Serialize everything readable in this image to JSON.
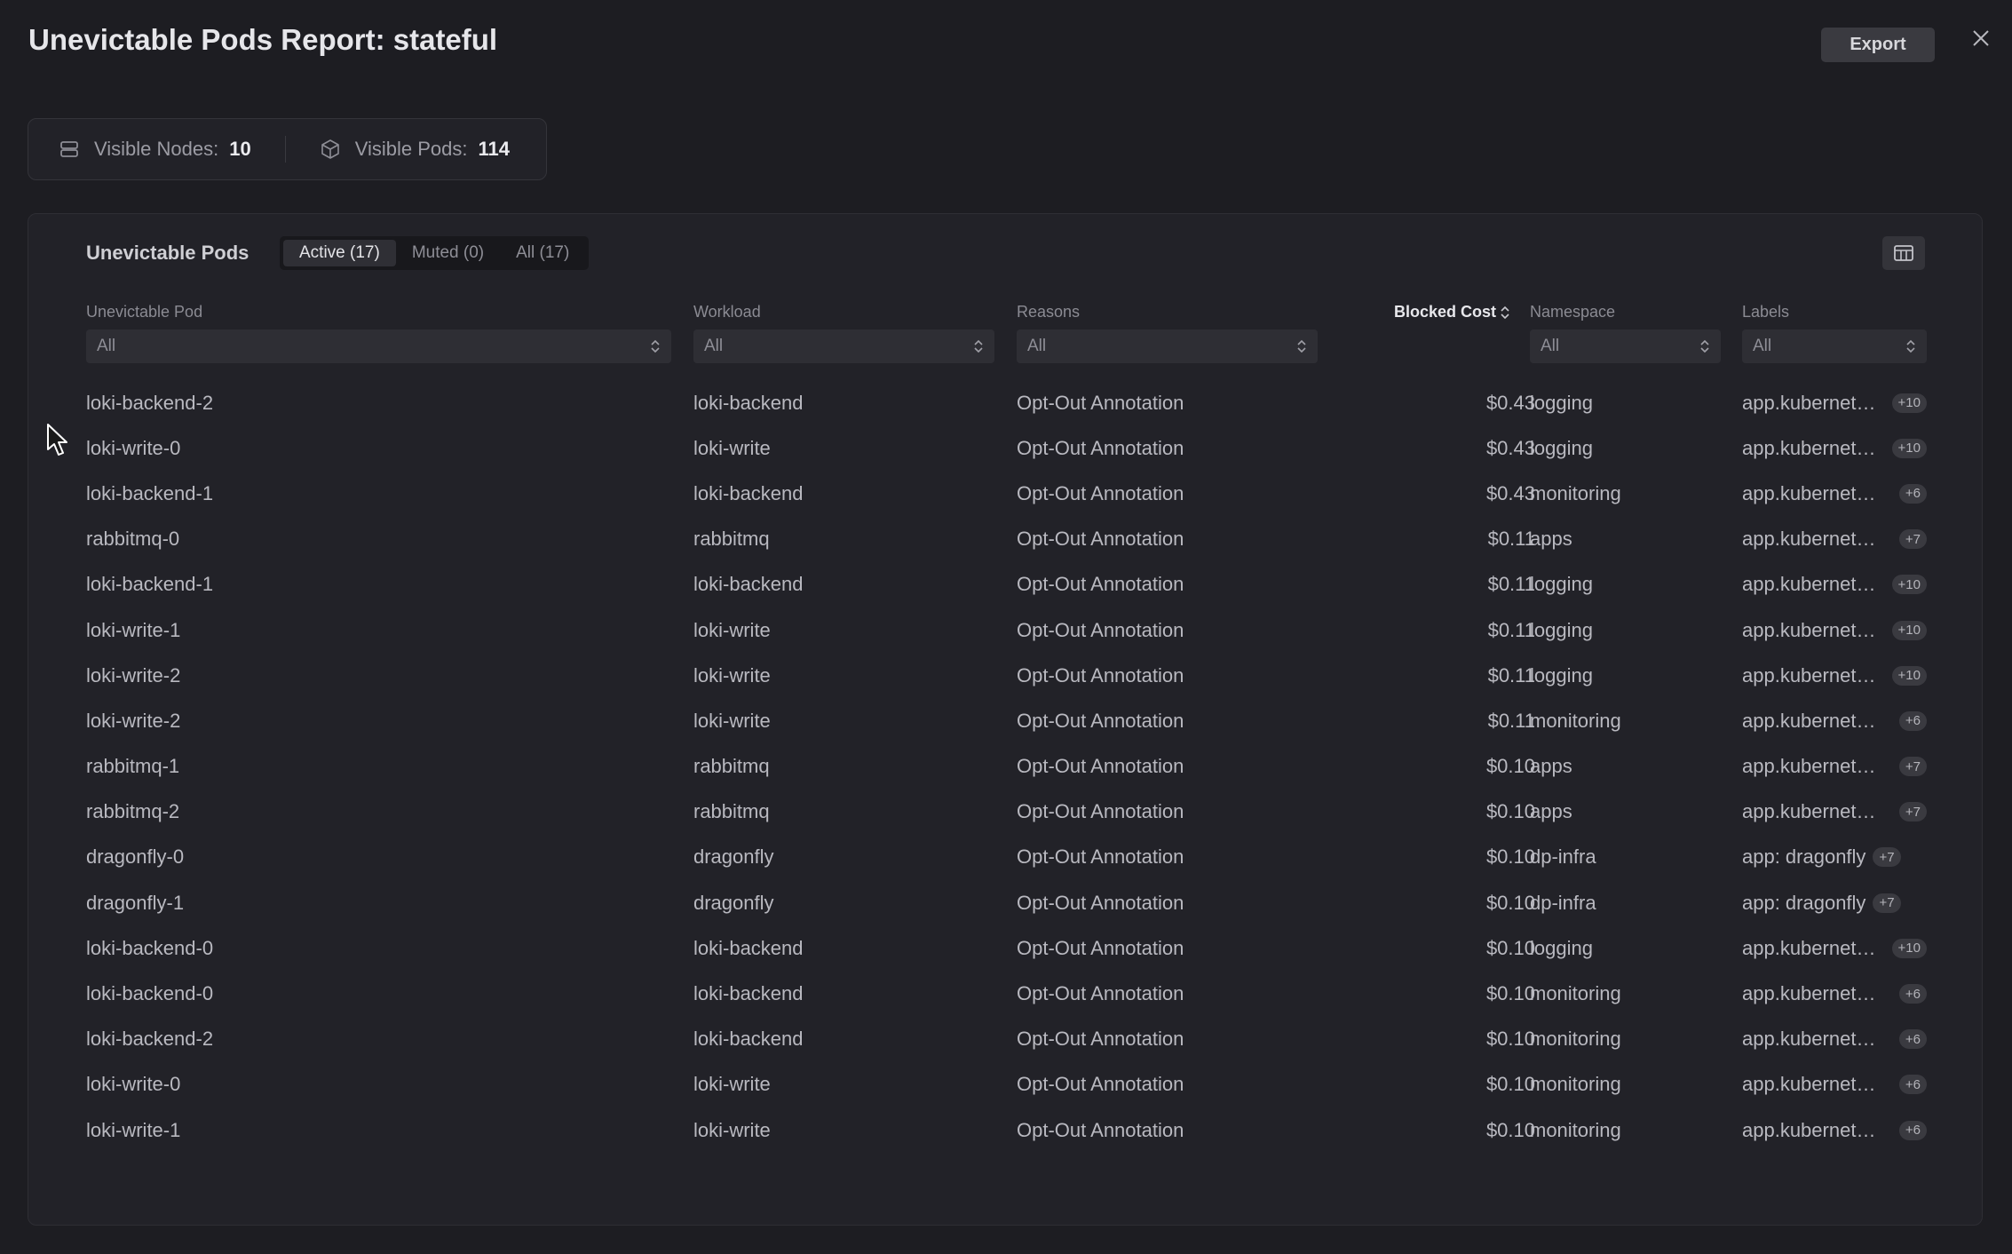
{
  "header": {
    "title": "Unevictable Pods Report: stateful",
    "export_label": "Export"
  },
  "stats": {
    "nodes_label": "Visible Nodes:",
    "nodes_value": "10",
    "pods_label": "Visible Pods:",
    "pods_value": "114"
  },
  "panel": {
    "title": "Unevictable Pods",
    "tabs": [
      {
        "label": "Active (17)",
        "active": true
      },
      {
        "label": "Muted (0)",
        "active": false
      },
      {
        "label": "All (17)",
        "active": false
      }
    ]
  },
  "columns": {
    "pod": "Unevictable Pod",
    "workload": "Workload",
    "reasons": "Reasons",
    "cost": "Blocked Cost",
    "namespace": "Namespace",
    "labels": "Labels"
  },
  "filters": {
    "pod": "All",
    "workload": "All",
    "reasons": "All",
    "namespace": "All",
    "labels": "All"
  },
  "rows": [
    {
      "pod": "loki-backend-2",
      "workload": "loki-backend",
      "reason": "Opt-Out Annotation",
      "cost": "$0.43",
      "namespace": "logging",
      "label": "app.kubernete...",
      "extra": "+10"
    },
    {
      "pod": "loki-write-0",
      "workload": "loki-write",
      "reason": "Opt-Out Annotation",
      "cost": "$0.43",
      "namespace": "logging",
      "label": "app.kubernete...",
      "extra": "+10"
    },
    {
      "pod": "loki-backend-1",
      "workload": "loki-backend",
      "reason": "Opt-Out Annotation",
      "cost": "$0.43",
      "namespace": "monitoring",
      "label": "app.kubernete...",
      "extra": "+6"
    },
    {
      "pod": "rabbitmq-0",
      "workload": "rabbitmq",
      "reason": "Opt-Out Annotation",
      "cost": "$0.11",
      "namespace": "apps",
      "label": "app.kubernete...",
      "extra": "+7"
    },
    {
      "pod": "loki-backend-1",
      "workload": "loki-backend",
      "reason": "Opt-Out Annotation",
      "cost": "$0.11",
      "namespace": "logging",
      "label": "app.kubernete...",
      "extra": "+10"
    },
    {
      "pod": "loki-write-1",
      "workload": "loki-write",
      "reason": "Opt-Out Annotation",
      "cost": "$0.11",
      "namespace": "logging",
      "label": "app.kubernete...",
      "extra": "+10"
    },
    {
      "pod": "loki-write-2",
      "workload": "loki-write",
      "reason": "Opt-Out Annotation",
      "cost": "$0.11",
      "namespace": "logging",
      "label": "app.kubernete...",
      "extra": "+10"
    },
    {
      "pod": "loki-write-2",
      "workload": "loki-write",
      "reason": "Opt-Out Annotation",
      "cost": "$0.11",
      "namespace": "monitoring",
      "label": "app.kubernete...",
      "extra": "+6"
    },
    {
      "pod": "rabbitmq-1",
      "workload": "rabbitmq",
      "reason": "Opt-Out Annotation",
      "cost": "$0.10",
      "namespace": "apps",
      "label": "app.kubernete...",
      "extra": "+7"
    },
    {
      "pod": "rabbitmq-2",
      "workload": "rabbitmq",
      "reason": "Opt-Out Annotation",
      "cost": "$0.10",
      "namespace": "apps",
      "label": "app.kubernete...",
      "extra": "+7"
    },
    {
      "pod": "dragonfly-0",
      "workload": "dragonfly",
      "reason": "Opt-Out Annotation",
      "cost": "$0.10",
      "namespace": "dp-infra",
      "label": "app: dragonfly",
      "extra": "+7"
    },
    {
      "pod": "dragonfly-1",
      "workload": "dragonfly",
      "reason": "Opt-Out Annotation",
      "cost": "$0.10",
      "namespace": "dp-infra",
      "label": "app: dragonfly",
      "extra": "+7"
    },
    {
      "pod": "loki-backend-0",
      "workload": "loki-backend",
      "reason": "Opt-Out Annotation",
      "cost": "$0.10",
      "namespace": "logging",
      "label": "app.kubernete...",
      "extra": "+10"
    },
    {
      "pod": "loki-backend-0",
      "workload": "loki-backend",
      "reason": "Opt-Out Annotation",
      "cost": "$0.10",
      "namespace": "monitoring",
      "label": "app.kubernete...",
      "extra": "+6"
    },
    {
      "pod": "loki-backend-2",
      "workload": "loki-backend",
      "reason": "Opt-Out Annotation",
      "cost": "$0.10",
      "namespace": "monitoring",
      "label": "app.kubernete...",
      "extra": "+6"
    },
    {
      "pod": "loki-write-0",
      "workload": "loki-write",
      "reason": "Opt-Out Annotation",
      "cost": "$0.10",
      "namespace": "monitoring",
      "label": "app.kubernete...",
      "extra": "+6"
    },
    {
      "pod": "loki-write-1",
      "workload": "loki-write",
      "reason": "Opt-Out Annotation",
      "cost": "$0.10",
      "namespace": "monitoring",
      "label": "app.kubernete...",
      "extra": "+6"
    }
  ]
}
